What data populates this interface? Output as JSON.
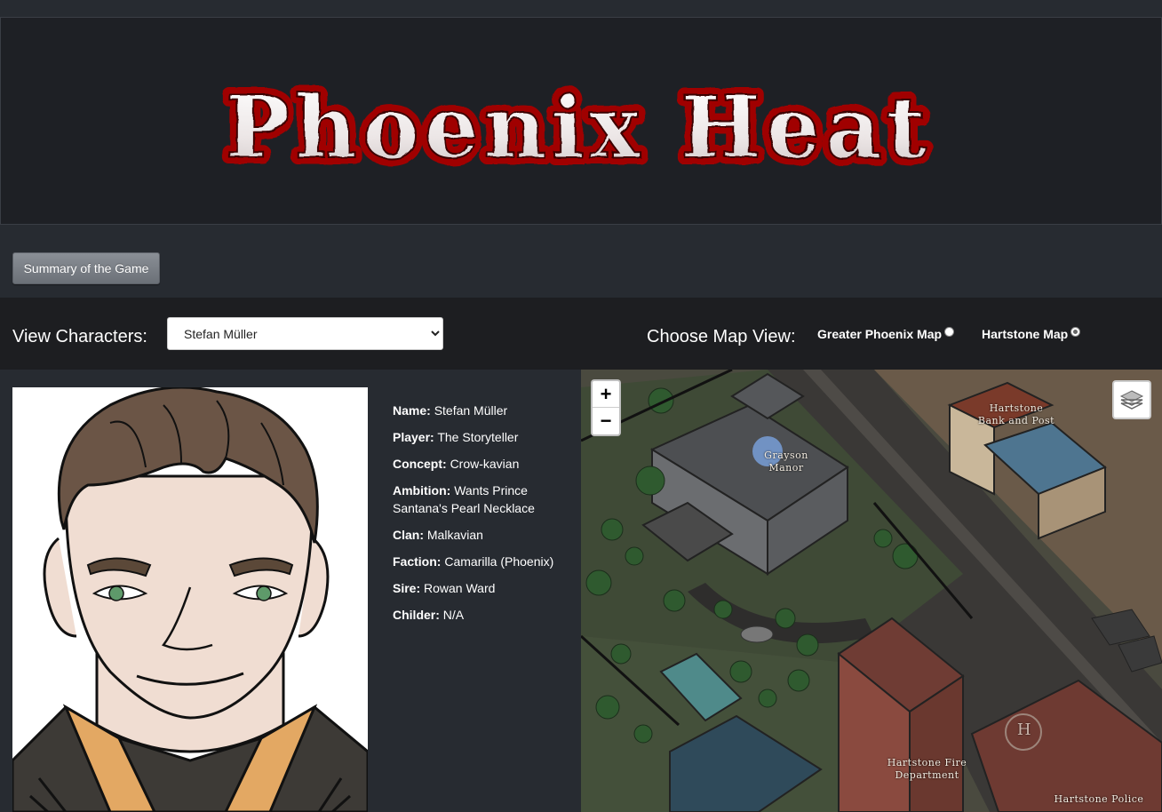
{
  "banner": {
    "title": "Phoenix Heat"
  },
  "toolbar": {
    "summary_label": "Summary of the Game"
  },
  "controls": {
    "view_label": "View Characters:",
    "selected_character": "Stefan Müller",
    "map_label": "Choose Map View:",
    "map_options": [
      {
        "label": "Greater Phoenix Map",
        "selected": false
      },
      {
        "label": "Hartstone Map",
        "selected": true
      }
    ]
  },
  "character": {
    "fields": [
      {
        "label": "Name:",
        "value": "Stefan Müller"
      },
      {
        "label": "Player:",
        "value": "The Storyteller"
      },
      {
        "label": "Concept:",
        "value": "Crow-kavian"
      },
      {
        "label": "Ambition:",
        "value": "Wants Prince Santana's Pearl Necklace"
      },
      {
        "label": "Clan:",
        "value": "Malkavian"
      },
      {
        "label": "Faction:",
        "value": "Camarilla (Phoenix)"
      },
      {
        "label": "Sire:",
        "value": "Rowan Ward"
      },
      {
        "label": "Childer:",
        "value": "N/A"
      }
    ]
  },
  "map": {
    "zoom_in": "+",
    "zoom_out": "−",
    "labels": {
      "grayson": "Grayson Manor",
      "bank": "Hartstone\nBank and Post",
      "fire": "Hartstone Fire\nDepartment",
      "police": "Hartstone Police",
      "helipad": "H"
    }
  }
}
